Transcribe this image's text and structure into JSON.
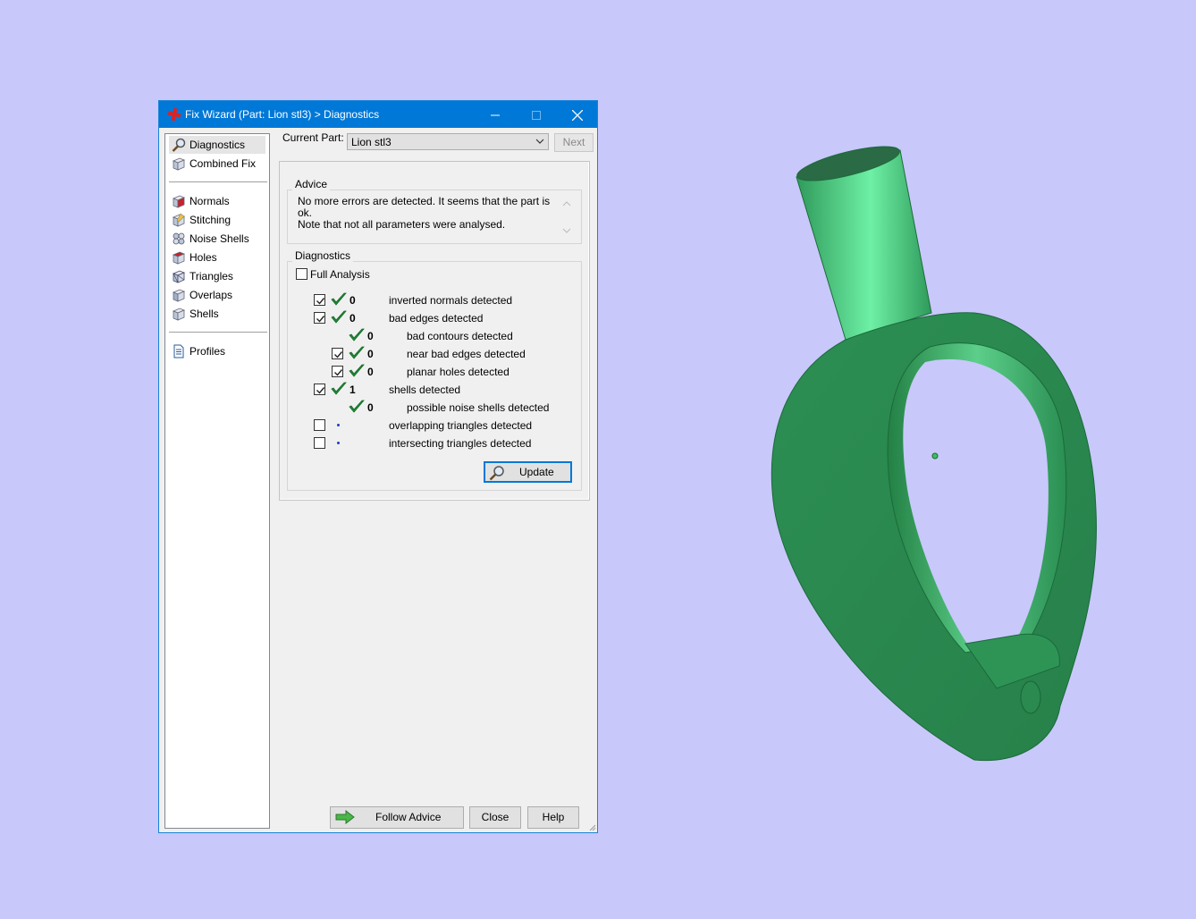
{
  "window": {
    "title": "Fix Wizard (Part: Lion stl3) > Diagnostics",
    "controls": [
      "minimize",
      "maximize",
      "close"
    ]
  },
  "sidebar": {
    "groups": [
      [
        {
          "label": "Diagnostics",
          "icon": "magnifier-icon",
          "selected": true
        },
        {
          "label": "Combined Fix",
          "icon": "combined-fix-icon"
        }
      ],
      [
        {
          "label": "Normals",
          "icon": "normals-icon"
        },
        {
          "label": "Stitching",
          "icon": "stitching-icon"
        },
        {
          "label": "Noise Shells",
          "icon": "noise-shells-icon"
        },
        {
          "label": "Holes",
          "icon": "holes-icon"
        },
        {
          "label": "Triangles",
          "icon": "triangles-icon"
        },
        {
          "label": "Overlaps",
          "icon": "overlaps-icon"
        },
        {
          "label": "Shells",
          "icon": "shells-icon"
        }
      ],
      [
        {
          "label": "Profiles",
          "icon": "profiles-icon"
        }
      ]
    ]
  },
  "toolbar": {
    "current_part_label": "Current Part:",
    "current_part_value": "Lion stl3",
    "next_label": "Next"
  },
  "advice": {
    "title": "Advice",
    "line1": "No more errors are detected. It seems that the part is ok.",
    "line2": "Note that not all parameters were analysed."
  },
  "diagnostics": {
    "title": "Diagnostics",
    "full_analysis_label": "Full Analysis",
    "full_analysis_checked": false,
    "rows": [
      {
        "checkbox": true,
        "checked": true,
        "status": "ok",
        "count": "0",
        "label": "inverted normals detected",
        "indent": 0
      },
      {
        "checkbox": true,
        "checked": true,
        "status": "ok",
        "count": "0",
        "label": "bad edges detected",
        "indent": 0
      },
      {
        "checkbox": false,
        "checked": false,
        "status": "ok",
        "count": "0",
        "label": "bad contours detected",
        "indent": 1
      },
      {
        "checkbox": true,
        "checked": true,
        "status": "ok",
        "count": "0",
        "label": "near bad edges detected",
        "indent": 1
      },
      {
        "checkbox": true,
        "checked": true,
        "status": "ok",
        "count": "0",
        "label": "planar holes detected",
        "indent": 1
      },
      {
        "checkbox": true,
        "checked": true,
        "status": "ok",
        "count": "1",
        "label": "shells detected",
        "indent": 0
      },
      {
        "checkbox": false,
        "checked": false,
        "status": "ok",
        "count": "0",
        "label": "possible noise shells detected",
        "indent": 1
      },
      {
        "checkbox": true,
        "checked": false,
        "status": "none",
        "count": "",
        "label": "overlapping triangles detected",
        "indent": 0
      },
      {
        "checkbox": true,
        "checked": false,
        "status": "none",
        "count": "",
        "label": "intersecting triangles detected",
        "indent": 0
      }
    ],
    "update_label": "Update"
  },
  "footer": {
    "follow_advice_label": "Follow Advice",
    "close_label": "Close",
    "help_label": "Help"
  },
  "viewport": {
    "background_color": "#c8c8fa",
    "model_color": "#2e9a5a"
  }
}
